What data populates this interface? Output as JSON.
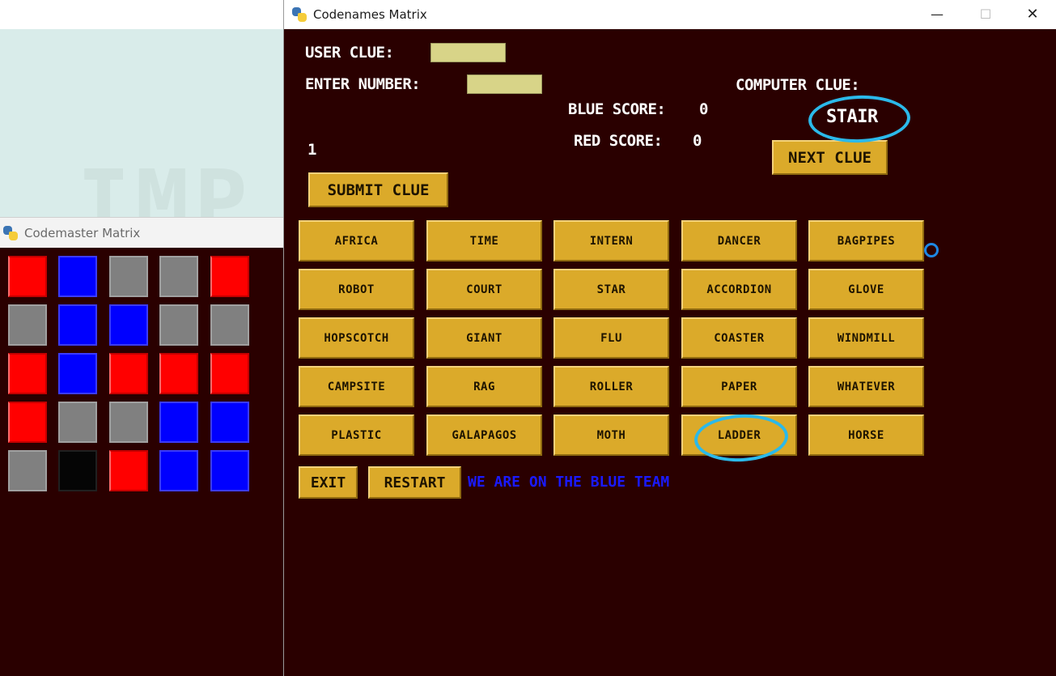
{
  "background_app": {
    "ghost_text": "IMP"
  },
  "codemaster": {
    "title": "Codemaster Matrix",
    "grid": [
      [
        "red",
        "blue",
        "gray",
        "gray",
        "red"
      ],
      [
        "gray",
        "blue",
        "blue",
        "gray",
        "gray"
      ],
      [
        "red",
        "blue",
        "red",
        "red",
        "red"
      ],
      [
        "red",
        "gray",
        "gray",
        "blue",
        "blue"
      ],
      [
        "gray",
        "black",
        "red",
        "blue",
        "blue"
      ]
    ]
  },
  "codenames": {
    "title": "Codenames Matrix",
    "window_controls": {
      "minimize": "—",
      "maximize": "☐",
      "close": "✕"
    },
    "user_clue_label": "USER CLUE:",
    "enter_number_label": "ENTER NUMBER:",
    "computer_clue_label": "COMPUTER CLUE:",
    "computer_clue": "STAIR",
    "blue_score_label": "BLUE SCORE:",
    "blue_score": "0",
    "red_score_label": "RED SCORE:",
    "red_score": "0",
    "clue_number": "1",
    "submit_clue": "SUBMIT CLUE",
    "next_clue": "NEXT CLUE",
    "words": [
      [
        "AFRICA",
        "TIME",
        "INTERN",
        "DANCER",
        "BAGPIPES"
      ],
      [
        "ROBOT",
        "COURT",
        "STAR",
        "ACCORDION",
        "GLOVE"
      ],
      [
        "HOPSCOTCH",
        "GIANT",
        "FLU",
        "COASTER",
        "WINDMILL"
      ],
      [
        "CAMPSITE",
        "RAG",
        "ROLLER",
        "PAPER",
        "WHATEVER"
      ],
      [
        "PLASTIC",
        "GALAPAGOS",
        "MOTH",
        "LADDER",
        "HORSE"
      ]
    ],
    "exit": "EXIT",
    "restart": "RESTART",
    "team_message": "WE ARE ON THE BLUE TEAM"
  },
  "colors": {
    "board_bg": "#2a0000",
    "button": "#dbaa2a",
    "entry": "#d8d488",
    "annotation": "#2bb9ea",
    "team_blue": "#1a1aff",
    "key_red": "#ff0000",
    "key_blue": "#0000ff",
    "key_gray": "#808080",
    "key_black": "#050505"
  }
}
